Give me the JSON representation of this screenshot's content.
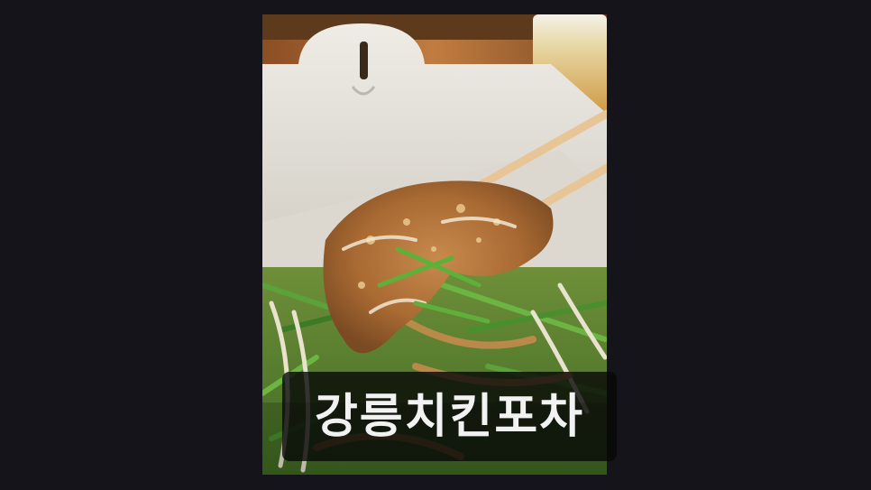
{
  "caption": {
    "text": "강릉치킨포차"
  },
  "photo": {
    "subject": "food-photo",
    "colors": {
      "background": "#15141a",
      "table_wood": "#b0703a",
      "box": "#e6e3dc",
      "sauce": "#b67a3e",
      "chives": "#4f8e2f",
      "caption_bg": "#080808",
      "caption_text": "#f2f2f2"
    }
  }
}
